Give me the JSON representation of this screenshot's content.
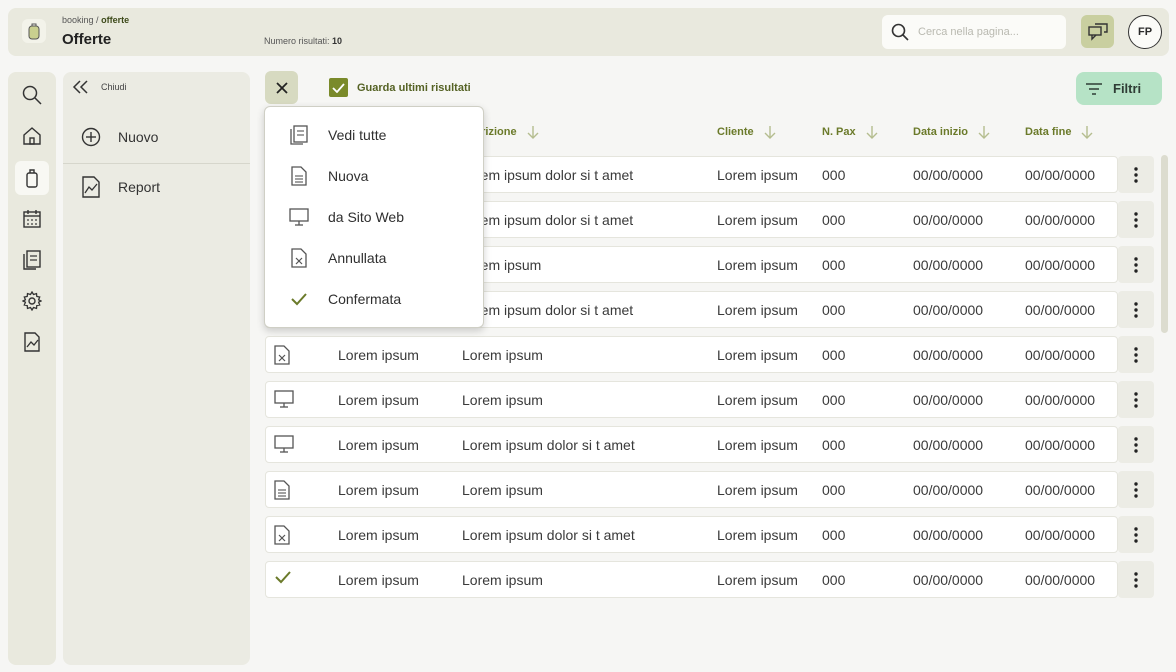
{
  "header": {
    "breadcrumb_root": "booking",
    "breadcrumb_sep": "/",
    "breadcrumb_current": "offerte",
    "title": "Offerte",
    "results_label": "Numero risultati:",
    "results_count": "10",
    "search_placeholder": "Cerca nella pagina...",
    "avatar_initials": "FP"
  },
  "panel": {
    "close_label": "Chiudi",
    "items": [
      {
        "label": "Nuovo",
        "icon": "plus-circle-icon"
      },
      {
        "label": "Report",
        "icon": "report-icon"
      }
    ]
  },
  "toolbar": {
    "checkbox_label": "Guarda ultimi risultati",
    "checkbox_checked": true,
    "filter_label": "Filtri"
  },
  "table": {
    "headers": [
      "crizione",
      "Cliente",
      "N. Pax",
      "Data inizio",
      "Data fine"
    ],
    "rows": [
      {
        "icon": "",
        "name": "",
        "desc": "rem ipsum dolor si t amet",
        "client": "Lorem ipsum",
        "pax": "000",
        "start": "00/00/0000",
        "end": "00/00/0000"
      },
      {
        "icon": "",
        "name": "",
        "desc": "rem ipsum dolor si t amet",
        "client": "Lorem ipsum",
        "pax": "000",
        "start": "00/00/0000",
        "end": "00/00/0000"
      },
      {
        "icon": "",
        "name": "",
        "desc": "rem ipsum",
        "client": "Lorem ipsum",
        "pax": "000",
        "start": "00/00/0000",
        "end": "00/00/0000"
      },
      {
        "icon": "",
        "name": "",
        "desc": "rem ipsum dolor si t amet",
        "client": "Lorem ipsum",
        "pax": "000",
        "start": "00/00/0000",
        "end": "00/00/0000"
      },
      {
        "icon": "cancelled-doc-icon",
        "name": "Lorem ipsum",
        "desc": "Lorem ipsum",
        "client": "Lorem ipsum",
        "pax": "000",
        "start": "00/00/0000",
        "end": "00/00/0000"
      },
      {
        "icon": "monitor-icon",
        "name": "Lorem ipsum",
        "desc": "Lorem ipsum",
        "client": "Lorem ipsum",
        "pax": "000",
        "start": "00/00/0000",
        "end": "00/00/0000"
      },
      {
        "icon": "monitor-icon",
        "name": "Lorem ipsum",
        "desc": "Lorem ipsum dolor si t amet",
        "client": "Lorem ipsum",
        "pax": "000",
        "start": "00/00/0000",
        "end": "00/00/0000"
      },
      {
        "icon": "document-icon",
        "name": "Lorem ipsum",
        "desc": "Lorem ipsum",
        "client": "Lorem ipsum",
        "pax": "000",
        "start": "00/00/0000",
        "end": "00/00/0000"
      },
      {
        "icon": "cancelled-doc-icon",
        "name": "Lorem ipsum",
        "desc": "Lorem ipsum dolor si t amet",
        "client": "Lorem ipsum",
        "pax": "000",
        "start": "00/00/0000",
        "end": "00/00/0000"
      },
      {
        "icon": "check-icon",
        "name": "Lorem ipsum",
        "desc": "Lorem ipsum",
        "client": "Lorem ipsum",
        "pax": "000",
        "start": "00/00/0000",
        "end": "00/00/0000"
      }
    ]
  },
  "dropdown": {
    "items": [
      {
        "label": "Vedi tutte",
        "icon": "all-docs-icon"
      },
      {
        "label": "Nuova",
        "icon": "document-icon"
      },
      {
        "label": "da Sito Web",
        "icon": "monitor-icon"
      },
      {
        "label": "Annullata",
        "icon": "cancelled-doc-icon"
      },
      {
        "label": "Confermata",
        "icon": "check-icon"
      }
    ]
  },
  "colors": {
    "accent": "#7a8a2a",
    "filter_bg": "#b6e3c6",
    "header_bg": "#e9e9de"
  }
}
